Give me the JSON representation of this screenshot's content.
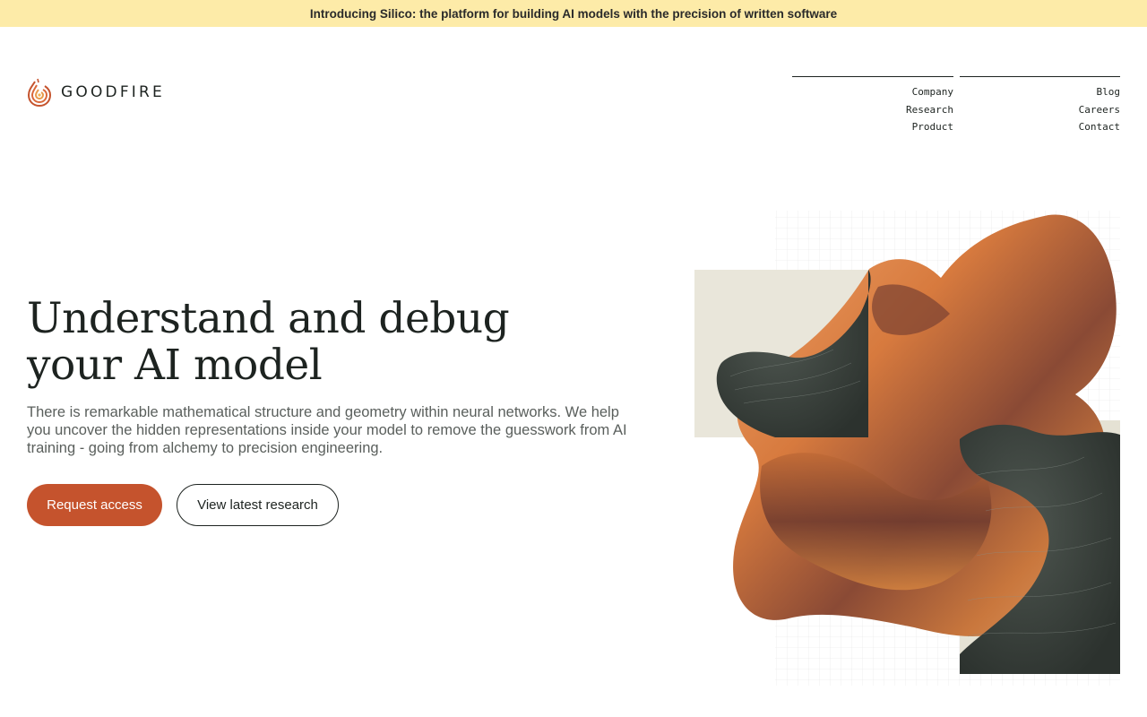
{
  "banner": {
    "text": "Introducing Silico: the platform for building AI models with the precision of written software"
  },
  "brand": {
    "name": "GOODFIRE",
    "logo_icon": "goodfire-flame-icon",
    "accent": "#c5532d"
  },
  "nav": {
    "col1": [
      "Company",
      "Research",
      "Product"
    ],
    "col2": [
      "Blog",
      "Careers",
      "Contact"
    ]
  },
  "hero": {
    "title_line1": "Understand and debug",
    "title_line2": "your AI model",
    "subtitle": "There is remarkable mathematical structure and geometry within neural networks. We help you uncover the hidden representations inside your model to remove the guesswork from AI training - going from alchemy to precision engineering.",
    "primary_cta": "Request access",
    "secondary_cta": "View latest research"
  },
  "colors": {
    "banner_bg": "#fdeba8",
    "primary_button": "#c5532d",
    "text": "#1d2320",
    "panel": "#e8e6d9"
  }
}
